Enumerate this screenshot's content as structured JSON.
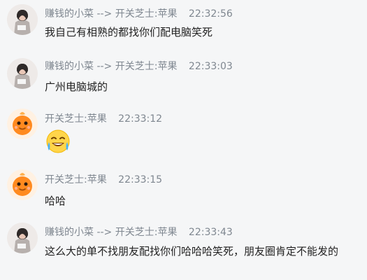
{
  "messages": [
    {
      "sender": "赚钱的小菜",
      "arrow": "-->",
      "recipient": "开关芝士:苹果",
      "time": "22:32:56",
      "text": "我自己有相熟的都找你们配电脑笑死",
      "avatar": "girl-photo-avatar"
    },
    {
      "sender": "赚钱的小菜",
      "arrow": "-->",
      "recipient": "开关芝士:苹果",
      "time": "22:33:03",
      "text": "广州电脑城的",
      "avatar": "girl-photo-avatar"
    },
    {
      "sender": "开关芝士:苹果",
      "time": "22:33:12",
      "emoji": "laughing-tears-emoji",
      "avatar": "orange-mascot-avatar"
    },
    {
      "sender": "开关芝士:苹果",
      "time": "22:33:15",
      "text": "哈哈",
      "avatar": "orange-mascot-avatar"
    },
    {
      "sender": "赚钱的小菜",
      "arrow": "-->",
      "recipient": "开关芝士:苹果",
      "time": "22:33:43",
      "text": "这么大的单不找朋友配找你们哈哈哈笑死，朋友圈肯定不能发的",
      "avatar": "girl-photo-avatar"
    }
  ],
  "colors": {
    "background": "#f5f6f7",
    "meta_text": "#7f8790",
    "message_text": "#222222",
    "mascot_orange": "#ff8a1f"
  }
}
